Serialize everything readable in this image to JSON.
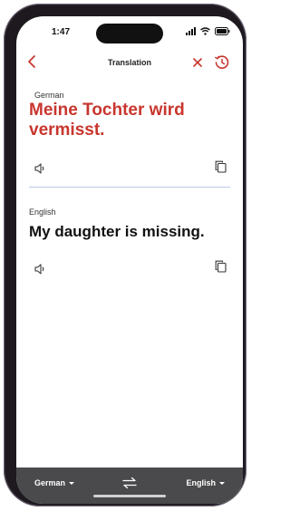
{
  "status": {
    "time": "1:47"
  },
  "header": {
    "title": "Translation"
  },
  "source": {
    "language": "German",
    "text": "Meine Tochter wird vermisst."
  },
  "target": {
    "language": "English",
    "text": "My daughter is missing."
  },
  "footer": {
    "left_language": "German",
    "right_language": "English"
  },
  "colors": {
    "accent": "#c8362e",
    "bottom_bar": "#4a4a4c",
    "divider": "#b9cce3"
  },
  "icons": {
    "back": "back-chevron-icon",
    "close": "close-icon",
    "history": "history-icon",
    "speaker": "speaker-icon",
    "copy": "copy-icon",
    "swap": "swap-languages-icon"
  }
}
